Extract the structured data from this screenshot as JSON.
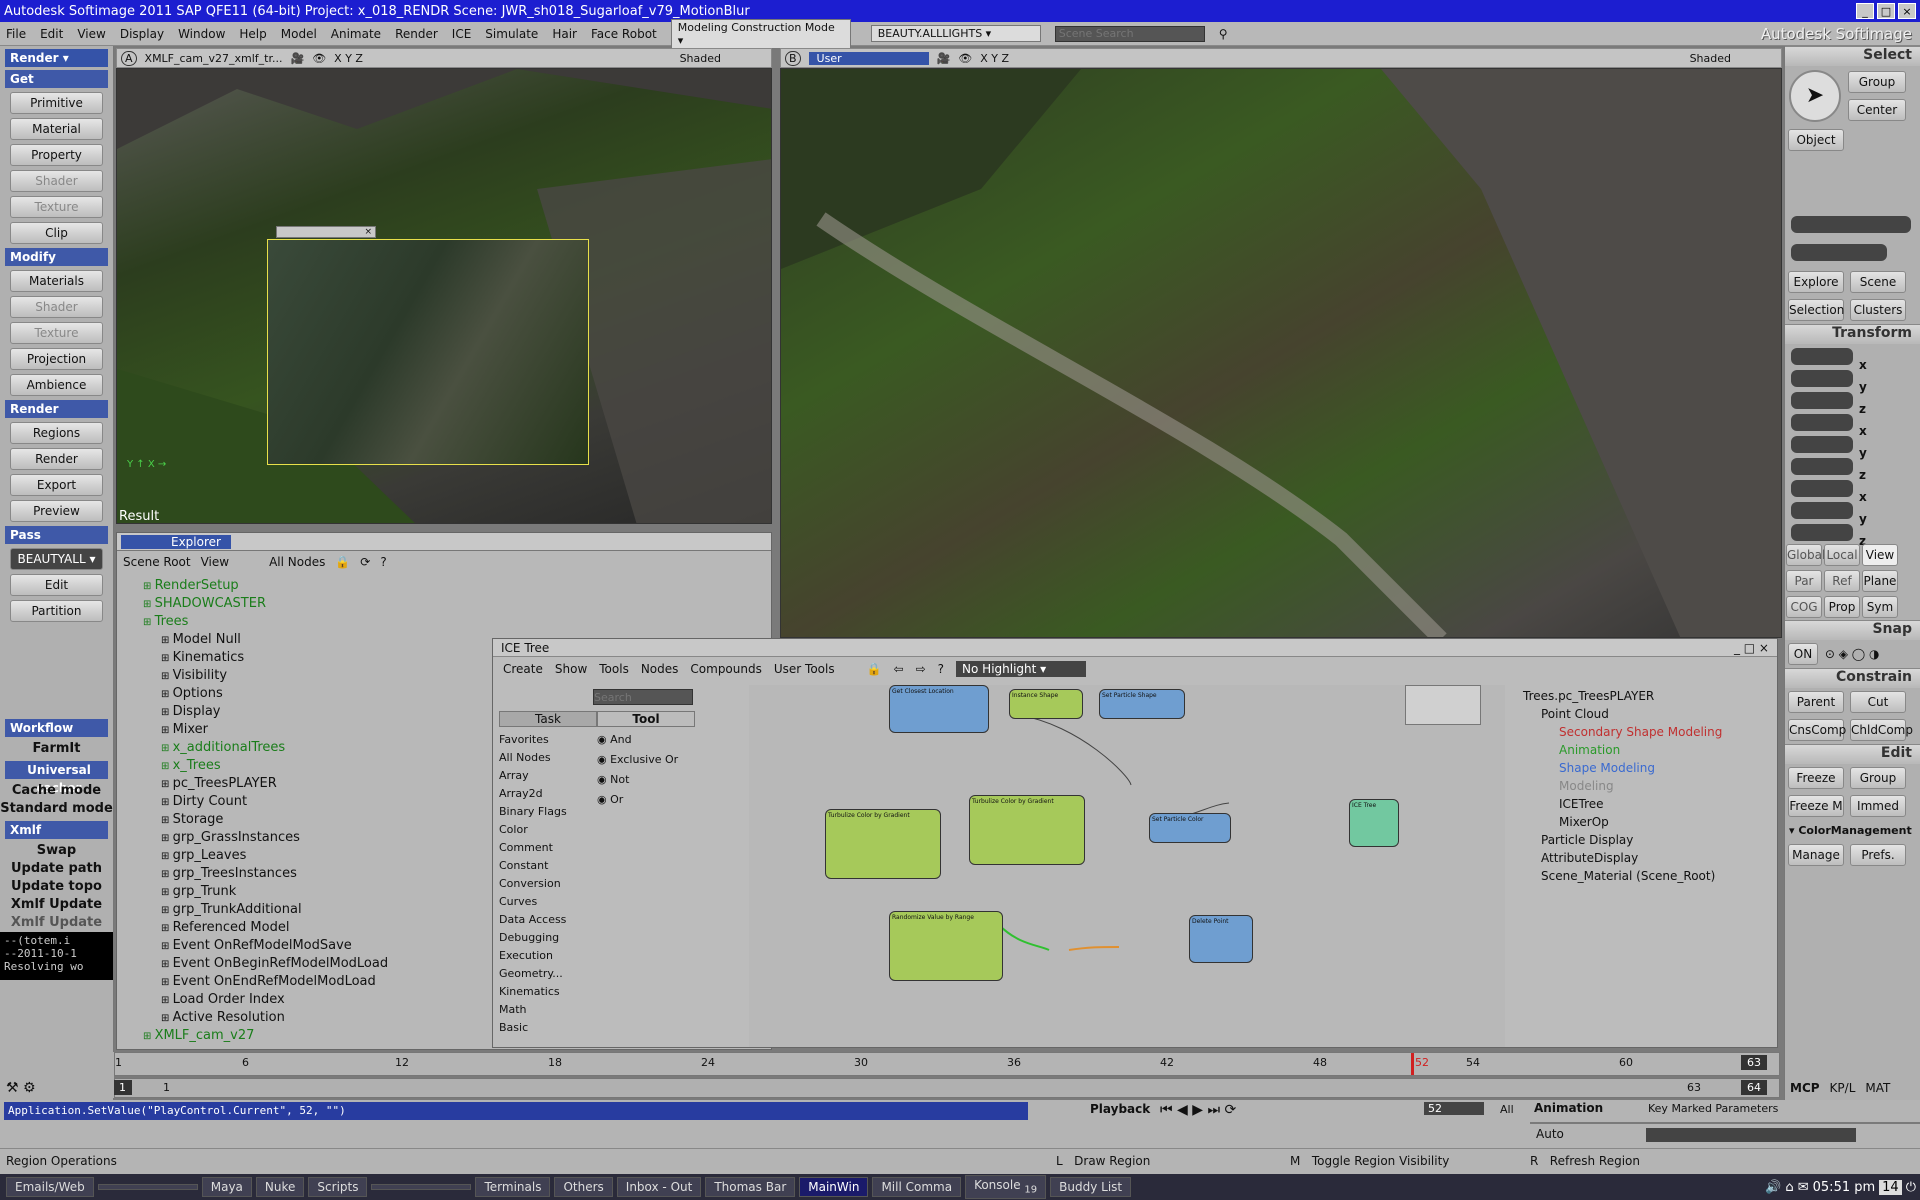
{
  "window": {
    "title": "Autodesk Softimage 2011 SAP QFE11 (64-bit)    Project: x_018_RENDR    Scene: JWR_sh018_Sugarloaf_v79_MotionBlur"
  },
  "menu": {
    "items": [
      "File",
      "Edit",
      "View",
      "Display",
      "Window",
      "Help",
      "Model",
      "Animate",
      "Render",
      "ICE",
      "Simulate",
      "Hair",
      "Face Robot"
    ],
    "mode": "Modeling Construction Mode",
    "pass": "BEAUTY.ALLLIGHTS",
    "search_placeholder": "Scene Search",
    "brand": "Autodesk Softimage"
  },
  "left_panel": {
    "module": "Render",
    "get_header": "Get",
    "get_buttons": [
      "Primitive",
      "Material",
      "Property",
      "Shader",
      "Texture",
      "Clip"
    ],
    "modify_header": "Modify",
    "modify_buttons": [
      "Materials",
      "Shader",
      "Texture",
      "Projection",
      "Ambience"
    ],
    "render_header": "Render",
    "render_buttons": [
      "Regions",
      "Render",
      "Export",
      "Preview"
    ],
    "pass_header": "Pass",
    "pass_current": "BEAUTYALL",
    "pass_buttons": [
      "Edit",
      "Partition"
    ],
    "workflow_header": "Workflow",
    "workflow_items": [
      "FarmIt",
      "Universal cacher",
      "Cache mode",
      "Standard mode",
      "Xmlf",
      "Swap",
      "Update path",
      "Update topo",
      "Xmlf Update",
      "Xmlf Update"
    ],
    "console_lines": [
      "--(totem.i",
      "--2011-10-1",
      "Resolving wo"
    ]
  },
  "viewport_a": {
    "letter": "A",
    "camera": "XMLF_cam_v27_xmlf_tr...",
    "axes": "X Y Z",
    "mode": "Shaded",
    "result_label": "Result"
  },
  "viewport_b": {
    "letter": "B",
    "camera": "User",
    "axes": "X Y Z",
    "mode": "Shaded"
  },
  "explorer": {
    "title": "Explorer",
    "scope": "Scene Root",
    "view": "View",
    "filter": "All Nodes",
    "items": [
      {
        "label": "RenderSetup",
        "indent": 0,
        "color": "green"
      },
      {
        "label": "SHADOWCASTER",
        "indent": 0,
        "color": "green"
      },
      {
        "label": "Trees",
        "indent": 0,
        "color": "green"
      },
      {
        "label": "Model Null",
        "indent": 1,
        "color": "black"
      },
      {
        "label": "Kinematics",
        "indent": 1,
        "color": "black"
      },
      {
        "label": "Visibility",
        "indent": 1,
        "color": "black"
      },
      {
        "label": "Options",
        "indent": 1,
        "color": "black"
      },
      {
        "label": "Display",
        "indent": 1,
        "color": "black"
      },
      {
        "label": "Mixer",
        "indent": 1,
        "color": "black"
      },
      {
        "label": "x_additionalTrees",
        "indent": 1,
        "color": "green"
      },
      {
        "label": "x_Trees",
        "indent": 1,
        "color": "green"
      },
      {
        "label": "pc_TreesPLAYER",
        "indent": 1,
        "color": "black"
      },
      {
        "label": "Dirty Count",
        "indent": 1,
        "color": "black"
      },
      {
        "label": "Storage",
        "indent": 1,
        "color": "black"
      },
      {
        "label": "grp_GrassInstances",
        "indent": 1,
        "color": "black"
      },
      {
        "label": "grp_Leaves",
        "indent": 1,
        "color": "black"
      },
      {
        "label": "grp_TreesInstances",
        "indent": 1,
        "color": "black"
      },
      {
        "label": "grp_Trunk",
        "indent": 1,
        "color": "black"
      },
      {
        "label": "grp_TrunkAdditional",
        "indent": 1,
        "color": "black"
      },
      {
        "label": "Referenced Model",
        "indent": 1,
        "color": "black"
      },
      {
        "label": "Event OnRefModelModSave",
        "indent": 1,
        "color": "black"
      },
      {
        "label": "Event OnBeginRefModelModLoad",
        "indent": 1,
        "color": "black"
      },
      {
        "label": "Event OnEndRefModelModLoad",
        "indent": 1,
        "color": "black"
      },
      {
        "label": "Load Order Index",
        "indent": 1,
        "color": "black"
      },
      {
        "label": "Active Resolution",
        "indent": 1,
        "color": "black"
      },
      {
        "label": "XMLF_cam_v27",
        "indent": 0,
        "color": "green"
      }
    ]
  },
  "ice_tree": {
    "title": "ICE Tree",
    "menu": [
      "Create",
      "Show",
      "Tools",
      "Nodes",
      "Compounds",
      "User Tools"
    ],
    "highlight": "No Highlight",
    "search_placeholder": "Search",
    "tabs": [
      "Task",
      "Tool"
    ],
    "categories": [
      "Favorites",
      "All Nodes",
      "Array",
      "Array2d",
      "Binary Flags",
      "Color",
      "Comment",
      "Constant",
      "Conversion",
      "Curves",
      "Data Access",
      "Debugging",
      "Execution",
      "Geometry...",
      "Kinematics",
      "Math",
      "Basic"
    ],
    "tool_items": [
      "And",
      "Exclusive Or",
      "Not",
      "Or"
    ],
    "nodes": [
      "Get Closest Location",
      "Instance Shape",
      "Set Particle Shape",
      "Turbulize Color by Gradient",
      "Turbulize Color by Gradient",
      "Set Particle Color",
      "ICE Tree",
      "Randomize Value by Range",
      "Delete Point"
    ],
    "stack": [
      {
        "label": "Trees.pc_TreesPLAYER",
        "indent": 0,
        "color": "#111"
      },
      {
        "label": "Point Cloud",
        "indent": 1,
        "color": "#111"
      },
      {
        "label": "Secondary Shape Modeling",
        "indent": 2,
        "color": "#c03030"
      },
      {
        "label": "Animation",
        "indent": 2,
        "color": "#2a9a2a"
      },
      {
        "label": "Shape Modeling",
        "indent": 2,
        "color": "#3a6ad0"
      },
      {
        "label": "Modeling",
        "indent": 2,
        "color": "#888"
      },
      {
        "label": "ICETree",
        "indent": 2,
        "color": "#111"
      },
      {
        "label": "MixerOp",
        "indent": 2,
        "color": "#111"
      },
      {
        "label": "Particle Display",
        "indent": 1,
        "color": "#111"
      },
      {
        "label": "AttributeDisplay",
        "indent": 1,
        "color": "#111"
      },
      {
        "label": "Scene_Material (Scene_Root)",
        "indent": 1,
        "color": "#111"
      }
    ]
  },
  "right_panel": {
    "select_header": "Select",
    "select_buttons": [
      "Group",
      "Center",
      "Object"
    ],
    "explore_buttons": [
      "Explore",
      "Scene",
      "Selection",
      "Clusters"
    ],
    "transform_header": "Transform",
    "axes": [
      "x",
      "y",
      "z"
    ],
    "ref_buttons": [
      "Global",
      "Local",
      "View",
      "Par",
      "Ref",
      "Plane"
    ],
    "cog_buttons": [
      "COG",
      "Prop",
      "Sym"
    ],
    "snap_header": "Snap",
    "snap_on": "ON",
    "constrain_header": "Constrain",
    "constrain_buttons": [
      "Parent",
      "Cut",
      "CnsComp",
      "ChldComp"
    ],
    "edit_header": "Edit",
    "edit_buttons": [
      "Freeze",
      "Group",
      "Freeze M",
      "Immed"
    ],
    "color_mgmt": "ColorManagement",
    "cm_buttons": [
      "Manage",
      "Prefs."
    ]
  },
  "timeline": {
    "ticks": [
      "1",
      "6",
      "12",
      "18",
      "24",
      "30",
      "36",
      "42",
      "48",
      "52",
      "54",
      "60"
    ],
    "current": "52",
    "end": "63",
    "start_field": "1",
    "range_start": "1",
    "range_end": "63",
    "end_field": "64",
    "tabs": [
      "MCP",
      "KP/L",
      "MAT"
    ]
  },
  "command": {
    "text": "Application.SetValue(\"PlayControl.Current\", 52, \"\")",
    "playback_label": "Playback",
    "frame": "52",
    "all_label": "All",
    "animation_label": "Animation",
    "auto_label": "Auto",
    "key_marked": "Key Marked Parameters"
  },
  "status": {
    "left": "Region Operations",
    "hints": [
      "Draw Region",
      "Toggle Region Visibility",
      "Refresh Region"
    ],
    "hint_keys": [
      "L",
      "M",
      "R"
    ]
  },
  "taskbar": {
    "items": [
      "Emails/Web",
      "",
      "Maya",
      "Nuke",
      "Scripts",
      "",
      "Terminals",
      "Others",
      "Inbox - Out",
      "Thomas Bar",
      "MainWin",
      "Mill Comma",
      "Konsole",
      "Buddy List"
    ],
    "clock": "05:51 pm",
    "date": "14",
    "konsole_count": "19"
  }
}
